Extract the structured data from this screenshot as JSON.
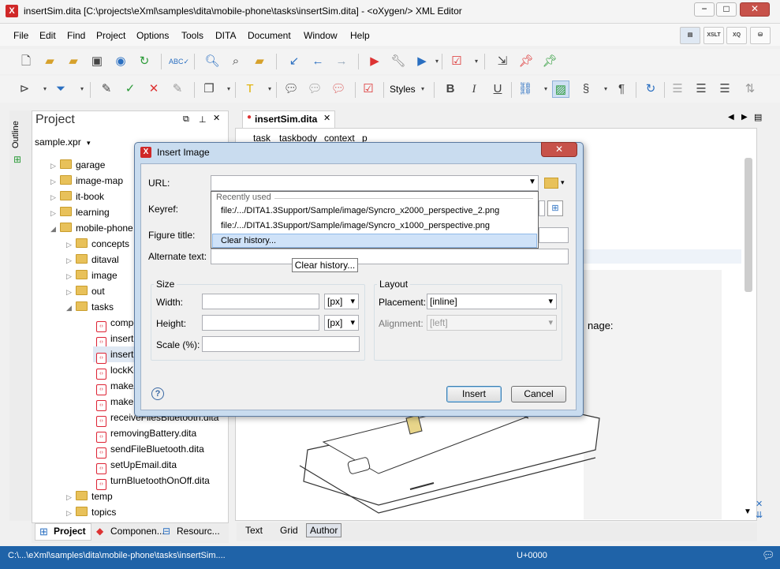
{
  "window": {
    "title": "insertSim.dita [C:\\projects\\eXml\\samples\\dita\\mobile-phone\\tasks\\insertSim.dita] - <oXygen/> XML Editor",
    "minimize": "−",
    "maximize": "□",
    "close": "✕"
  },
  "menu": [
    "File",
    "Edit",
    "Find",
    "Project",
    "Options",
    "Tools",
    "DITA",
    "Document",
    "Window",
    "Help"
  ],
  "perspectives": [
    "",
    "XSLT",
    "XQ",
    ""
  ],
  "toolbar2": {
    "styles_label": "Styles"
  },
  "sidebar": {
    "outline_label": "Outline"
  },
  "project": {
    "title": "Project",
    "file": "sample.xpr",
    "tree": [
      {
        "label": "garage",
        "type": "folder",
        "expanded": false
      },
      {
        "label": "image-map",
        "type": "folder",
        "expanded": false
      },
      {
        "label": "it-book",
        "type": "folder",
        "expanded": false
      },
      {
        "label": "learning",
        "type": "folder",
        "expanded": false
      },
      {
        "label": "mobile-phone",
        "type": "folder",
        "expanded": true
      },
      {
        "label": "concepts",
        "type": "folder",
        "expanded": false
      },
      {
        "label": "ditaval",
        "type": "folder",
        "expanded": false
      },
      {
        "label": "image",
        "type": "folder",
        "expanded": false
      },
      {
        "label": "out",
        "type": "folder",
        "expanded": false
      },
      {
        "label": "tasks",
        "type": "folder",
        "expanded": true
      },
      {
        "label": "compo",
        "type": "file"
      },
      {
        "label": "insertE",
        "type": "file"
      },
      {
        "label": "insertS",
        "type": "file"
      },
      {
        "label": "lockKe",
        "type": "file"
      },
      {
        "label": "makeA",
        "type": "file"
      },
      {
        "label": "makeC",
        "type": "file"
      },
      {
        "label": "receiveFilesBluetooth.dita",
        "type": "file"
      },
      {
        "label": "removingBattery.dita",
        "type": "file"
      },
      {
        "label": "sendFileBluetooth.dita",
        "type": "file"
      },
      {
        "label": "setUpEmail.dita",
        "type": "file"
      },
      {
        "label": "turnBluetoothOnOff.dita",
        "type": "file"
      },
      {
        "label": "temp",
        "type": "folder",
        "expanded": false
      },
      {
        "label": "topics",
        "type": "folder",
        "expanded": false
      }
    ],
    "bottom_tabs": [
      "Project",
      "Componen...",
      "Resourc..."
    ]
  },
  "editor": {
    "tab": "insertSim.dita",
    "breadcrumb": [
      "task",
      "taskbody",
      "context",
      "p"
    ],
    "partial_text": "nage:",
    "bottom_tabs": [
      "Text",
      "Grid",
      "Author"
    ],
    "active_bottom_tab": "Author"
  },
  "status": {
    "path": "C:\\...\\eXml\\samples\\dita\\mobile-phone\\tasks\\insertSim....",
    "char": "U+0000"
  },
  "dialog": {
    "title": "Insert Image",
    "url_label": "URL:",
    "keyref_label": "Keyref:",
    "figure_title_label": "Figure title:",
    "alt_text_label": "Alternate text:",
    "recent_header": "Recently used",
    "recent": [
      "file:/.../DITA1.3Support/Sample/image/Syncro_x2000_perspective_2.png",
      "file:/.../DITA1.3Support/Sample/image/Syncro_x1000_perspective.png"
    ],
    "clear_history": "Clear history...",
    "tooltip": "Clear history...",
    "size": {
      "title": "Size",
      "width_label": "Width:",
      "height_label": "Height:",
      "scale_label": "Scale (%):",
      "unit": "[px]"
    },
    "layout": {
      "title": "Layout",
      "placement_label": "Placement:",
      "placement_value": "[inline]",
      "alignment_label": "Alignment:",
      "alignment_value": "[left]"
    },
    "insert_button": "Insert",
    "cancel_button": "Cancel"
  }
}
